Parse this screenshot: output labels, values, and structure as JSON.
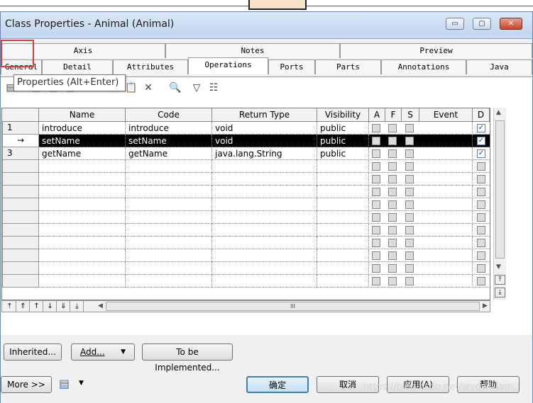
{
  "window": {
    "title": "Class Properties - Animal (Animal)",
    "minimize": "▭",
    "maximize": "▢",
    "close": "✕"
  },
  "tabs_row1": [
    "Axis",
    "Notes",
    "Preview"
  ],
  "tabs_row2": [
    "General",
    "Detail",
    "Attributes",
    "Operations",
    "Ports",
    "Parts",
    "Annotations",
    "Java"
  ],
  "tooltip": "Properties (Alt+Enter)",
  "toolbar_icons": [
    "properties-icon",
    "add-row-icon",
    "insert-row-icon",
    "add-objects-icon",
    "cut-icon",
    "copy-icon",
    "paste-icon",
    "delete-icon",
    "find-icon",
    "filter-icon",
    "customize-columns-icon"
  ],
  "toolbar_glyphs": [
    "▤",
    "▦",
    "▥",
    "▣",
    "✂",
    "⎘",
    "📋",
    "✕",
    "🔍",
    "▽",
    "☷"
  ],
  "grid": {
    "columns": [
      "Name",
      "Code",
      "Return Type",
      "Visibility",
      "A",
      "F",
      "S",
      "Event",
      "D"
    ],
    "rows": [
      {
        "num": "1",
        "name": "introduce",
        "code": "introduce",
        "return": "void",
        "visibility": "public",
        "d": "✓"
      },
      {
        "num": "→",
        "name": "setName",
        "code": "setName",
        "return": "void",
        "visibility": "public",
        "d": "✓"
      },
      {
        "num": "3",
        "name": "getName",
        "code": "getName",
        "return": "java.lang.String",
        "visibility": "public",
        "d": "✓"
      }
    ]
  },
  "nav_buttons": [
    "⤒",
    "⇑",
    "↑",
    "↓",
    "⇓",
    "⤓"
  ],
  "scroll_hint": "III",
  "buttons": {
    "inherited": "Inherited...",
    "add": "Add...",
    "add_arrow": "▼",
    "to_be_implemented": "To be Implemented..."
  },
  "footer": {
    "more": "More >>",
    "print_icon": "▤",
    "print_arrow": "▼",
    "ok": "确定",
    "cancel": "取消",
    "apply": "应用(A)",
    "help": "帮助"
  },
  "watermark": "https://blog.csdn.net/wyqwilliam"
}
